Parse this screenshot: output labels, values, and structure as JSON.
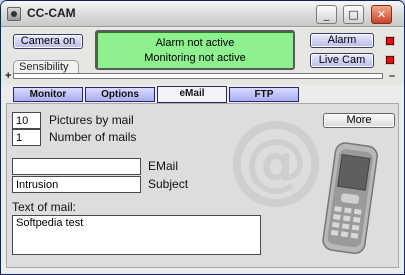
{
  "window": {
    "title": "CC-CAM",
    "icon": "camera-icon",
    "controls": {
      "minimize": "_",
      "maximize": "□",
      "close": "✕"
    }
  },
  "top": {
    "camera_button": "Camera on",
    "status_line1": "Alarm not active",
    "status_line2": "Monitoring not active",
    "alarm_button": "Alarm",
    "livecam_button": "Live Cam",
    "sensibility_label": "Sensibility",
    "sens_minus": "+",
    "sens_plus": "–",
    "status_color": "#8ef08e",
    "led_color": "#e01010"
  },
  "tabs": [
    {
      "label": "Monitor"
    },
    {
      "label": "Options"
    },
    {
      "label": "eMail"
    },
    {
      "label": "FTP"
    }
  ],
  "email_panel": {
    "pictures_value": "10",
    "pictures_label": "Pictures by mail",
    "mails_value": "1",
    "mails_label": "Number of mails",
    "more_button": "More",
    "email_value": "",
    "email_label": "EMail",
    "subject_value": "Intrusion",
    "subject_label": "Subject",
    "text_label": "Text of mail:",
    "text_value": "Softpedia test"
  }
}
